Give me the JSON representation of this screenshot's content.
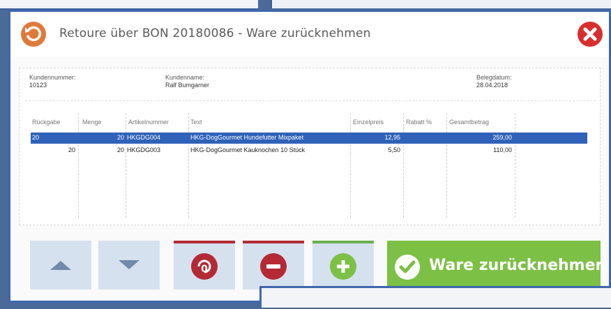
{
  "dialog": {
    "title": "Retoure über BON 20180086 - Ware zurücknehmen"
  },
  "header": {
    "customer_number_label": "Kundennummer:",
    "customer_number": "10123",
    "customer_name_label": "Kundenname:",
    "customer_name": "Ralf Bumgarner",
    "receipt_date_label": "Belegdatum:",
    "receipt_date": "28.04.2018"
  },
  "table": {
    "columns": [
      "Rückgabe",
      "Menge",
      "Artikelnummer",
      "Text",
      "Einzelpreis",
      "Rabatt %",
      "Gesamtbetrag"
    ],
    "rows": [
      {
        "rueckgabe": "20",
        "menge": "20",
        "artikelnummer": "HKGDG004",
        "text": "HKG-DogGourmet Hundefutter Mixpaket",
        "einzelpreis": "12,95",
        "rabatt": "",
        "gesamt": "259,00",
        "selected": true
      },
      {
        "rueckgabe": "20",
        "menge": "20",
        "artikelnummer": "HKGDG003",
        "text": "HKG-DogGourmet Kauknochen 10 Stück",
        "einzelpreis": "5,50",
        "rabatt": "",
        "gesamt": "110,00",
        "selected": false
      }
    ]
  },
  "buttons": {
    "confirm_label": "Ware zurücknehmen"
  },
  "colors": {
    "accent_blue": "#3f67ad",
    "selection": "#2f62b8",
    "danger": "#b32a35",
    "success": "#7cc046",
    "return_icon": "#e07a3a",
    "close_icon": "#d92e2e"
  },
  "icons": [
    "return-arrow-icon",
    "close-icon",
    "arrow-up-icon",
    "arrow-down-icon",
    "undo-circle-icon",
    "minus-circle-icon",
    "plus-circle-icon",
    "check-circle-icon"
  ]
}
